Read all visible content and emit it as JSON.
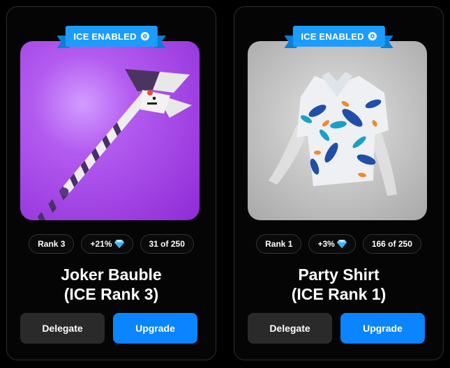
{
  "cards": [
    {
      "badge": "ICE ENABLED",
      "stats": {
        "rank": "Rank 3",
        "bonus": "+21%",
        "supply": "31 of 250"
      },
      "title_line1": "Joker Bauble",
      "title_line2": "(ICE Rank 3)",
      "delegate_label": "Delegate",
      "upgrade_label": "Upgrade",
      "art_bg": "#a646e8"
    },
    {
      "badge": "ICE ENABLED",
      "stats": {
        "rank": "Rank 1",
        "bonus": "+3%",
        "supply": "166 of 250"
      },
      "title_line1": "Party Shirt",
      "title_line2": "(ICE Rank 1)",
      "delegate_label": "Delegate",
      "upgrade_label": "Upgrade",
      "art_bg": "#c4c4c4"
    }
  ],
  "colors": {
    "accent_blue": "#0a84ff",
    "badge_blue": "#1c9cff",
    "delegate_bg": "#2a2a2a",
    "card_border": "#2e2e2e",
    "page_bg": "#000000"
  },
  "icons": {
    "badge": "ice-icon",
    "bonus": "diamond-icon"
  }
}
